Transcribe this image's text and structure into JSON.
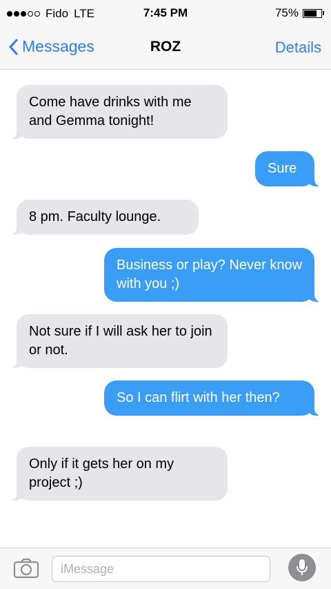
{
  "status_bar": {
    "carrier": "Fido",
    "network": "LTE",
    "signal_bars_filled": 3,
    "signal_bars_total": 5,
    "time": "7:45 PM",
    "battery_percent_label": "75%",
    "battery_level": 0.75
  },
  "nav": {
    "back_label": "Messages",
    "title": "ROZ",
    "details_label": "Details"
  },
  "messages": [
    {
      "direction": "incoming",
      "text": "Come have drinks with me and Gemma tonight!"
    },
    {
      "direction": "outgoing",
      "text": "Sure"
    },
    {
      "direction": "incoming",
      "text": "8 pm. Faculty lounge."
    },
    {
      "direction": "outgoing",
      "text": "Business or play? Never know with you ;)"
    },
    {
      "direction": "incoming",
      "text": "Not sure if I will ask her to join or not."
    },
    {
      "direction": "outgoing",
      "text": "So I can flirt with her then?"
    },
    {
      "direction": "incoming",
      "text": "Only if it gets her on my project ;)"
    }
  ],
  "input": {
    "placeholder": "iMessage",
    "value": ""
  },
  "icons": {
    "back": "chevron-left-icon",
    "camera": "camera-icon",
    "mic": "microphone-icon",
    "battery": "battery-icon"
  },
  "colors": {
    "accent": "#2e7cf6",
    "outgoing_bubble": "#3a9ef7",
    "incoming_bubble": "#e5e5ea",
    "bar_background": "#f7f7f7"
  }
}
